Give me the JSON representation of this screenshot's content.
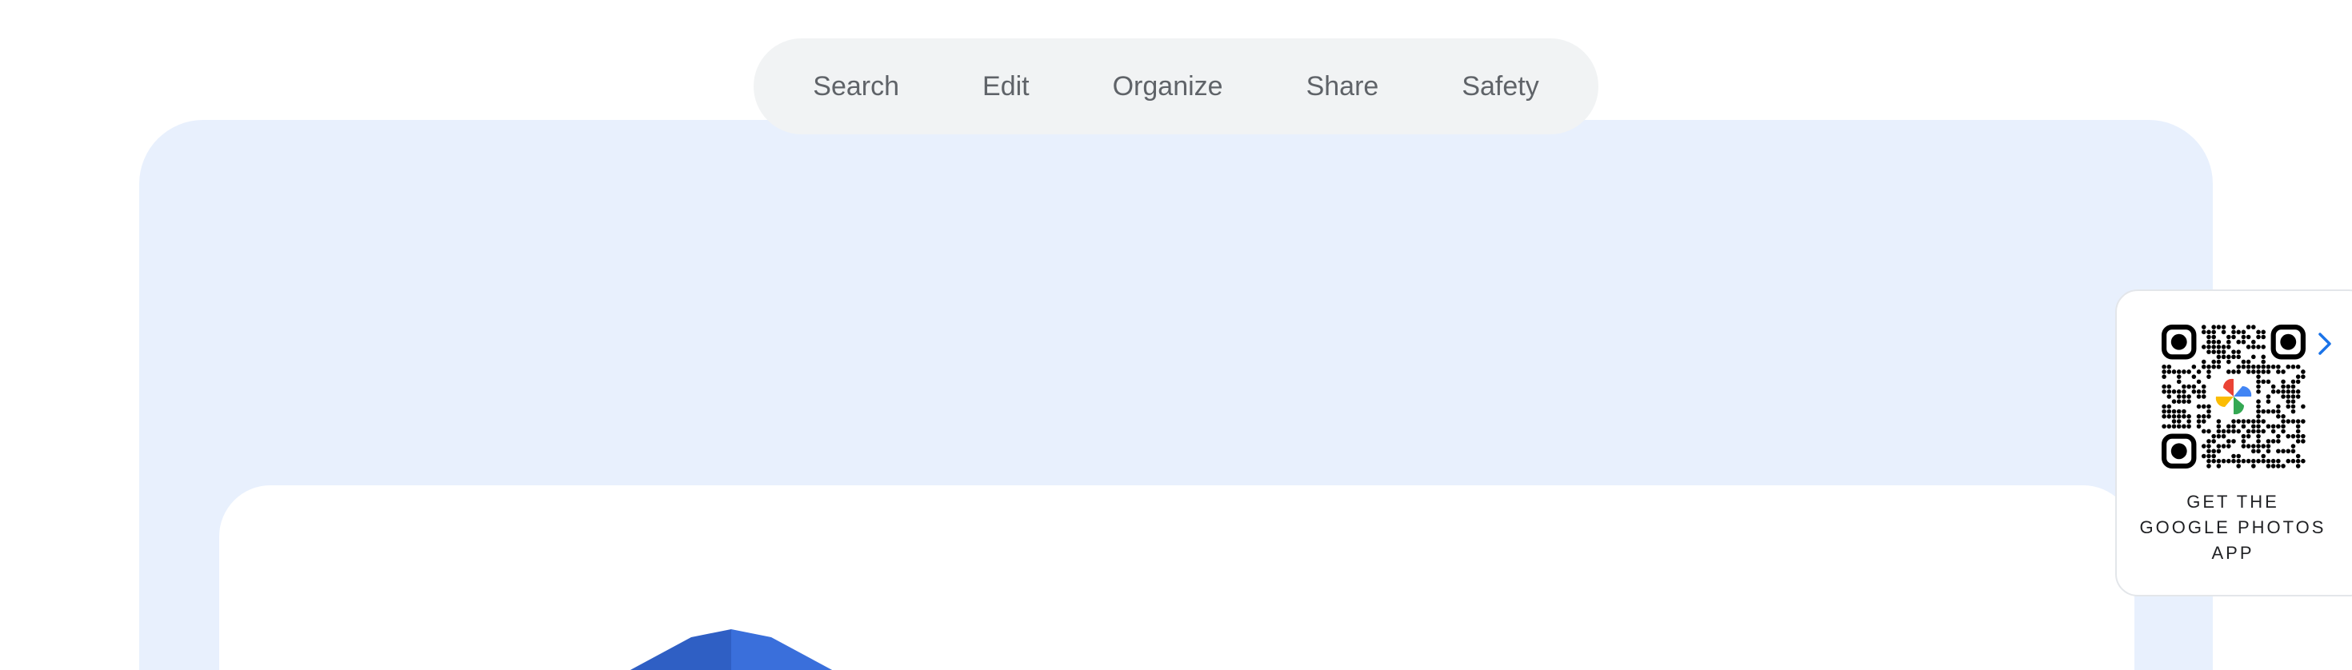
{
  "nav": {
    "tabs": [
      {
        "label": "Search"
      },
      {
        "label": "Edit"
      },
      {
        "label": "Organize"
      },
      {
        "label": "Share"
      },
      {
        "label": "Safety"
      }
    ]
  },
  "qr_widget": {
    "caption_lines": [
      "GET THE",
      "GOOGLE PHOTOS",
      "APP"
    ],
    "icons": {
      "code": "qr-code-icon",
      "logo": "google-photos-pinwheel-icon",
      "arrow": "chevron-right-icon"
    }
  },
  "colors": {
    "hero_background": "#e8f0fd",
    "tab_nav_background": "#f1f3f4",
    "tab_text": "#5f6368",
    "accent_blue": "#1a73e8",
    "illustration_blue": "#3367d6"
  }
}
